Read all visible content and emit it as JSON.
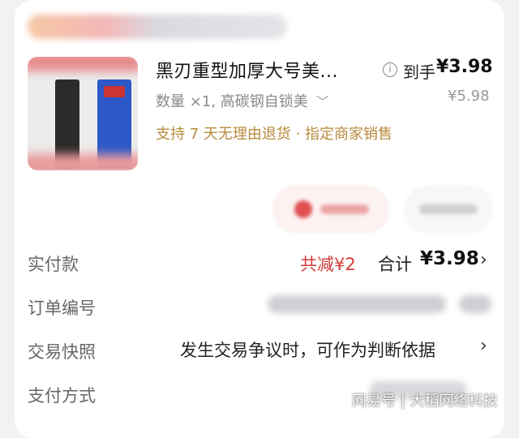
{
  "product": {
    "title": "黑刃重型加厚大号美...",
    "spec": "数量 ×1, 高碳钢自锁美",
    "spec_chevron": "﹀",
    "promise": "支持 7 天无理由退货 · 指定商家销售",
    "info_icon": "i",
    "received_label": "到手",
    "received_price": "¥3.98",
    "original_price": "¥5.98"
  },
  "payment": {
    "label": "实付款",
    "saving": "共减¥2",
    "total_label": "合计",
    "total_value": "¥3.98",
    "chevron": "›"
  },
  "order": {
    "label": "订单编号"
  },
  "snapshot": {
    "label": "交易快照",
    "text": "发生交易争议时，可作为判断依据",
    "chevron": "›"
  },
  "pay_method": {
    "label": "支付方式"
  },
  "watermark": "网易号 | 大稻网络科技",
  "colors": {
    "accent_red": "#d23a3a",
    "promise_gold": "#b88a3c",
    "background": "#f2f2f2",
    "card": "#ffffff"
  }
}
